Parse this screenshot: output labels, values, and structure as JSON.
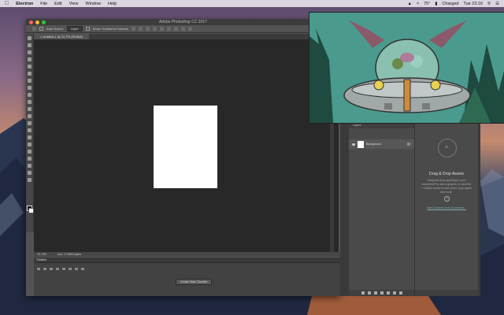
{
  "menubar": {
    "app_name": "Electron",
    "menus": [
      "File",
      "Edit",
      "View",
      "Window",
      "Help"
    ],
    "status": {
      "temperature": "75°",
      "battery": "Charged",
      "clock": "Tue 23:16"
    }
  },
  "photoshop": {
    "window_title": "Adobe Photoshop CC 2017",
    "options": {
      "auto_select_label": "Auto-Select:",
      "auto_select_value": "Layer",
      "transform_label": "Show Transform Controls"
    },
    "document_tab": "Untitled-1 @ 22,7% (RGB/8)",
    "status": {
      "zoom": "22,73%",
      "doc_size": "Doc: 17,8M/0 bytes"
    },
    "timeline": {
      "title": "Timeline",
      "create_button": "Create Video Timeline"
    },
    "layers": {
      "tab": "Layers",
      "background_layer": "Background"
    },
    "libraries": {
      "title": "Drag & Drop Assets",
      "description": "Drag and drop anything in your document® to add a graphic, or click the '+' button below to add colors, type styles and more.",
      "link": "Start Libraries from Document..."
    }
  },
  "colors": {
    "canvas_bg": "#282828",
    "panel_bg": "#535353",
    "accent_link": "#88aabb"
  }
}
